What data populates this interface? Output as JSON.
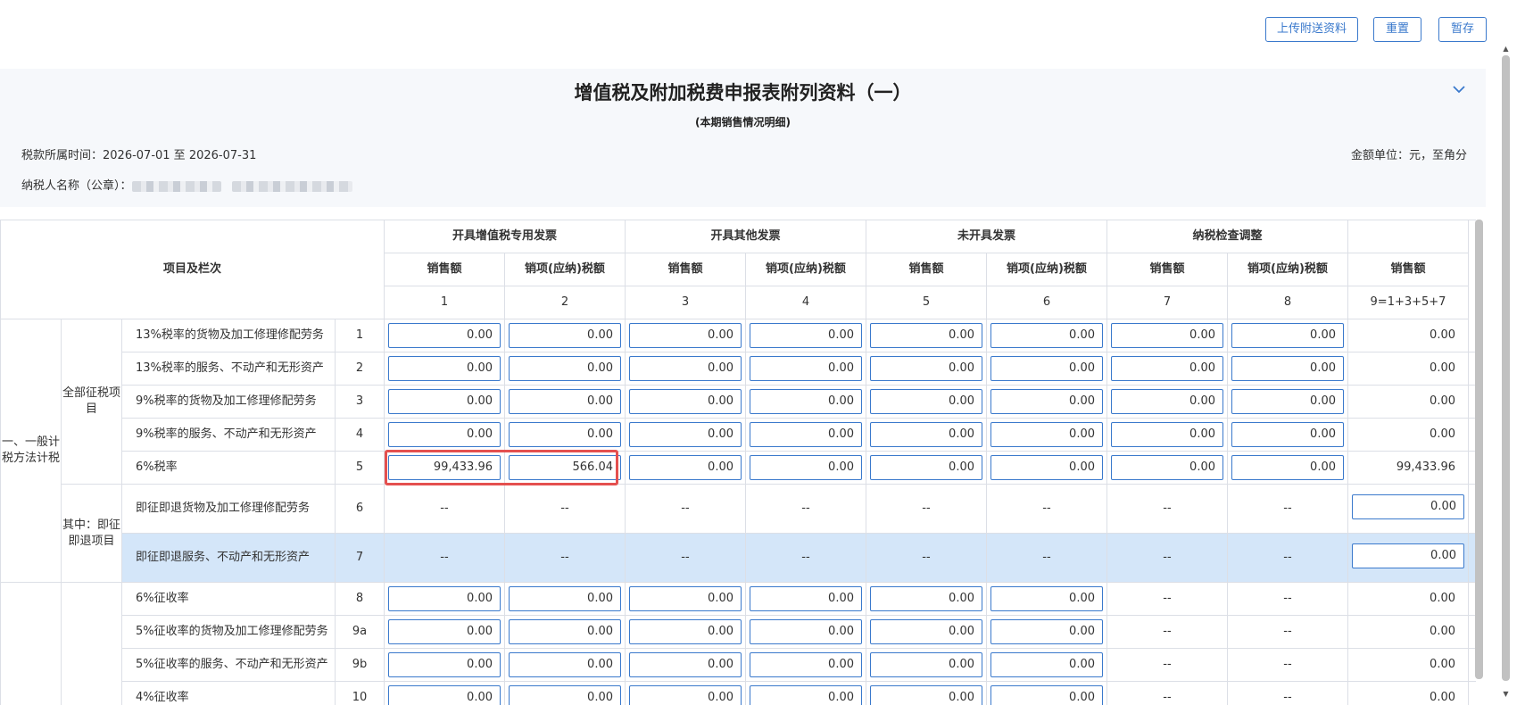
{
  "toolbar": {
    "upload_label": "上传附送资料",
    "reset_label": "重置",
    "save_label": "暂存"
  },
  "header": {
    "title": "增值税及附加税费申报表附列资料（一）",
    "subtitle": "(本期销售情况明细)",
    "period": "税款所属时间：2026-07-01 至 2026-07-31",
    "taxpayer_label": "纳税人名称（公章）：",
    "unit": "金额单位：元，至角分"
  },
  "table": {
    "item_header": "项目及栏次",
    "groups": [
      "开具增值税专用发票",
      "开具其他发票",
      "未开具发票",
      "纳税检查调整"
    ],
    "sub_headers": [
      "销售额",
      "销项(应纳)税额",
      "销售额",
      "销项(应纳)税额",
      "销售额",
      "销项(应纳)税额",
      "销售额",
      "销项(应纳)税额",
      "销售额"
    ],
    "col_numbers": [
      "1",
      "2",
      "3",
      "4",
      "5",
      "6",
      "7",
      "8",
      "9=1+3+5+7"
    ],
    "section1_label": "一、一般计税方法计税",
    "group_all_label": "全部征税项目",
    "group_refund_label": "其中：即征即退项目",
    "dash": "--",
    "rows": [
      {
        "name": "13%税率的货物及加工修理修配劳务",
        "line": "1",
        "values": [
          "0.00",
          "0.00",
          "0.00",
          "0.00",
          "0.00",
          "0.00",
          "0.00",
          "0.00"
        ],
        "total": "0.00"
      },
      {
        "name": "13%税率的服务、不动产和无形资产",
        "line": "2",
        "values": [
          "0.00",
          "0.00",
          "0.00",
          "0.00",
          "0.00",
          "0.00",
          "0.00",
          "0.00"
        ],
        "total": "0.00"
      },
      {
        "name": "9%税率的货物及加工修理修配劳务",
        "line": "3",
        "values": [
          "0.00",
          "0.00",
          "0.00",
          "0.00",
          "0.00",
          "0.00",
          "0.00",
          "0.00"
        ],
        "total": "0.00"
      },
      {
        "name": "9%税率的服务、不动产和无形资产",
        "line": "4",
        "values": [
          "0.00",
          "0.00",
          "0.00",
          "0.00",
          "0.00",
          "0.00",
          "0.00",
          "0.00"
        ],
        "total": "0.00"
      },
      {
        "name": "6%税率",
        "line": "5",
        "values": [
          "99,433.96",
          "566.04",
          "0.00",
          "0.00",
          "0.00",
          "0.00",
          "0.00",
          "0.00"
        ],
        "total": "99,433.96"
      },
      {
        "name": "即征即退货物及加工修理修配劳务",
        "line": "6",
        "total": "0.00"
      },
      {
        "name": "即征即退服务、不动产和无形资产",
        "line": "7",
        "total": "0.00"
      },
      {
        "name": "6%征收率",
        "line": "8",
        "values": [
          "0.00",
          "0.00",
          "0.00",
          "0.00",
          "0.00",
          "0.00"
        ],
        "total": "0.00"
      },
      {
        "name": "5%征收率的货物及加工修理修配劳务",
        "line": "9a",
        "values": [
          "0.00",
          "0.00",
          "0.00",
          "0.00",
          "0.00",
          "0.00"
        ],
        "total": "0.00"
      },
      {
        "name": "5%征收率的服务、不动产和无形资产",
        "line": "9b",
        "values": [
          "0.00",
          "0.00",
          "0.00",
          "0.00",
          "0.00",
          "0.00"
        ],
        "total": "0.00"
      },
      {
        "name": "4%征收率",
        "line": "10",
        "values": [
          "0.00",
          "0.00",
          "0.00",
          "0.00",
          "0.00",
          "0.00"
        ],
        "total": "0.00"
      }
    ]
  },
  "colors": {
    "accent": "#3a79cc",
    "highlight_row": "#d4e6f9",
    "annotation_red": "#e4504f"
  },
  "icons": {
    "collapse": "chevron-down-icon"
  }
}
